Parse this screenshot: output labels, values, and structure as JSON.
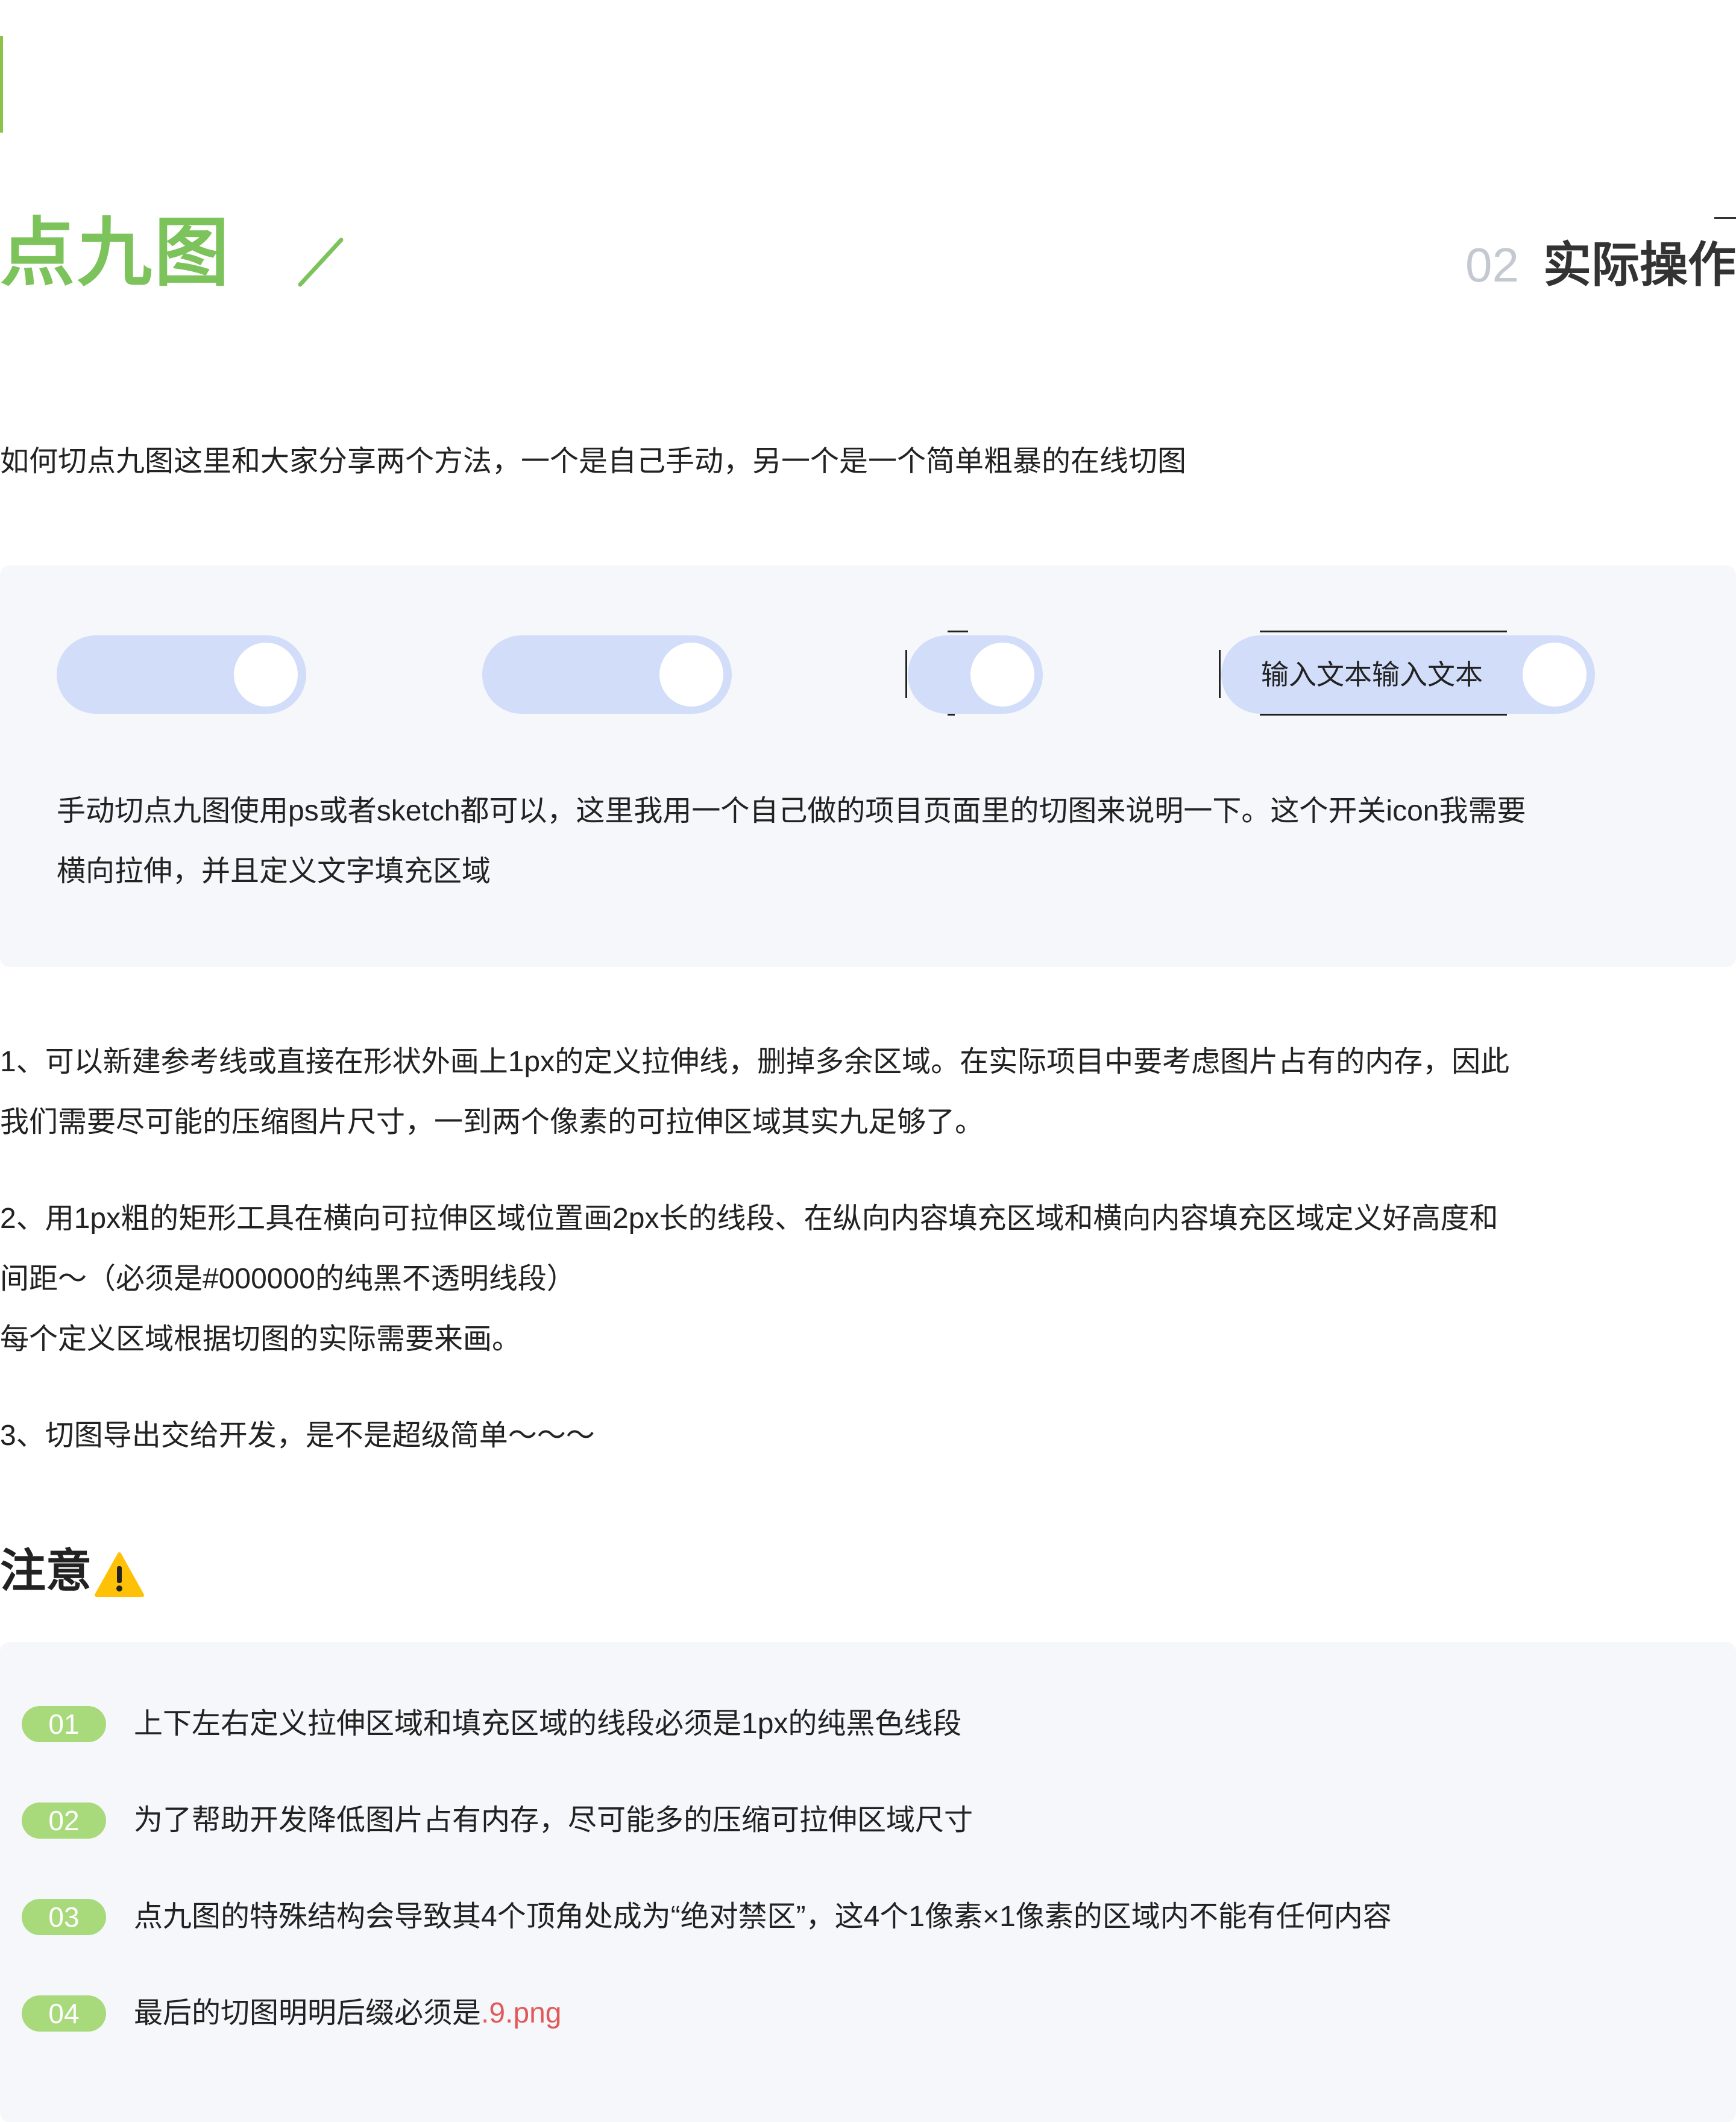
{
  "header": {
    "title": "点九图",
    "section_number": "02",
    "section_label": "实际操作"
  },
  "intro": "如何切点九图这里和大家分享两个方法，一个是自己手动，另一个是一个简单粗暴的在线切图",
  "demo_panel": {
    "toggle_text": "输入文本输入文本",
    "description_line1": "手动切点九图使用ps或者sketch都可以，这里我用一个自己做的项目页面里的切图来说明一下。这个开关icon我需要",
    "description_line2": "横向拉伸，并且定义文字填充区域"
  },
  "steps": {
    "step1_line1": "1、可以新建参考线或直接在形状外画上1px的定义拉伸线，删掉多余区域。在实际项目中要考虑图片占有的内存，因此",
    "step1_line2": "我们需要尽可能的压缩图片尺寸，一到两个像素的可拉伸区域其实九足够了。",
    "step2_line1": "2、用1px粗的矩形工具在横向可拉伸区域位置画2px长的线段、在纵向内容填充区域和横向内容填充区域定义好高度和",
    "step2_line2": "间距～（必须是#000000的纯黑不透明线段）",
    "step2_line3": "每个定义区域根据切图的实际需要来画。",
    "step3": "3、切图导出交给开发，是不是超级简单～～～"
  },
  "notes": {
    "heading": "注意",
    "items": [
      {
        "badge": "01",
        "text": "上下左右定义拉伸区域和填充区域的线段必须是1px的纯黑色线段",
        "highlight": ""
      },
      {
        "badge": "02",
        "text": "为了帮助开发降低图片占有内存，尽可能多的压缩可拉伸区域尺寸",
        "highlight": ""
      },
      {
        "badge": "03",
        "text": "点九图的特殊结构会导致其4个顶角处成为“绝对禁区”，这4个1像素×1像素的区域内不能有任何内容",
        "highlight": ""
      },
      {
        "badge": "04",
        "text": "最后的切图明明后缀必须是",
        "highlight": ".9.png"
      }
    ]
  },
  "colors": {
    "accent_green": "#7cc35b",
    "badge_green": "#a8d97a",
    "toggle_blue": "#d1ddf9",
    "panel_bg": "#f6f7fa",
    "highlight_red": "#e05a5a"
  },
  "icons": [
    "slash-divider-icon",
    "warning-icon"
  ]
}
